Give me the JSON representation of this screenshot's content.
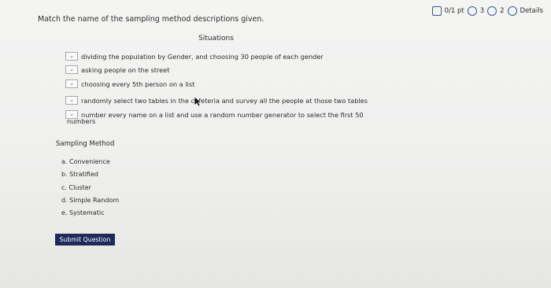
{
  "header": {
    "score": "0/1 pt",
    "attempts": "3",
    "retries": "2",
    "details": "Details"
  },
  "question": {
    "prompt": "Match the name of the sampling method descriptions given."
  },
  "situations": {
    "heading": "Situations",
    "items": [
      "dividing the population by Gender, and choosing 30 people of each gender",
      "asking people on the street",
      "choosing every 5th person on a list",
      "randomly select two tables in the cafeteria and survey all the people at those two tables",
      "number every name on a list and use a random number generator to select the first 50"
    ],
    "item5_wrap": "numbers",
    "dropdown_glyph": "⌄"
  },
  "methods": {
    "heading": "Sampling Method",
    "options": [
      "a. Convenience",
      "b. Stratified",
      "c. Cluster",
      "d. Simple Random",
      "e. Systematic"
    ]
  },
  "submit": {
    "label": "Submit Question"
  },
  "colors": {
    "submit_bg": "#1e2a5a",
    "accent": "#3a5a8c"
  }
}
